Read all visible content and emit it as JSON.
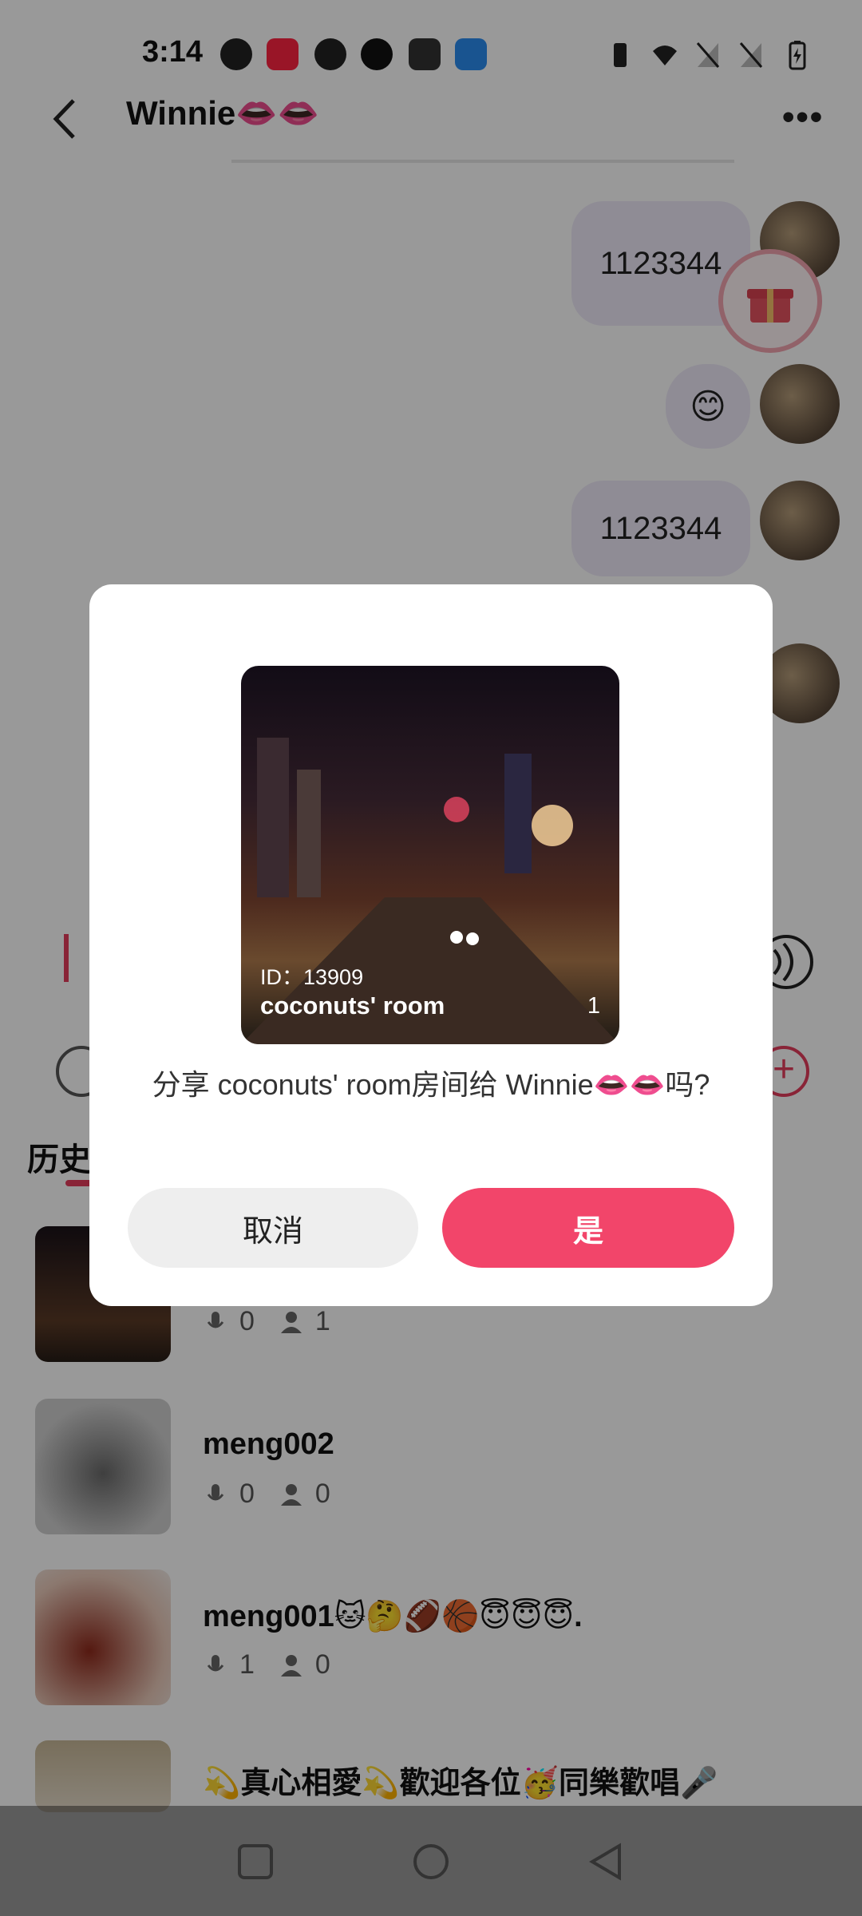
{
  "status_bar": {
    "time": "3:14",
    "app_icons": [
      "lock-app-icon",
      "xiaohongshu-icon",
      "facebook-icon",
      "tiktok-icon",
      "wallet-icon",
      "browser-icon"
    ],
    "right_icons": [
      "vibrate-icon",
      "wifi-icon",
      "no-sim-icon",
      "no-sim-icon",
      "battery-charging-icon"
    ]
  },
  "header": {
    "title": "Winnie👄👄",
    "more_label": "•••"
  },
  "messages": [
    {
      "text": "1123344"
    },
    {
      "text": "😊"
    },
    {
      "text": "1123344"
    }
  ],
  "section": {
    "title": "历史"
  },
  "rooms": [
    {
      "name": "",
      "mic": "0",
      "listeners": "1"
    },
    {
      "name": "meng002",
      "mic": "0",
      "listeners": "0"
    },
    {
      "name": "meng001🐱🤔🏈🏀😇😇😇.",
      "mic": "1",
      "listeners": "0"
    },
    {
      "name": "💫真心相愛💫歡迎各位🥳同樂歡唱🎤"
    }
  ],
  "dialog": {
    "room_id": "ID：13909",
    "room_name": "coconuts' room",
    "room_count": "1",
    "prompt": "分享 coconuts' room房间给 Winnie👄👄吗?",
    "cancel_label": "取消",
    "confirm_label": "是"
  },
  "colors": {
    "accent": "#f2456a",
    "bubble": "#eeeaf9",
    "scrim": "rgba(0,0,0,0.40)"
  }
}
